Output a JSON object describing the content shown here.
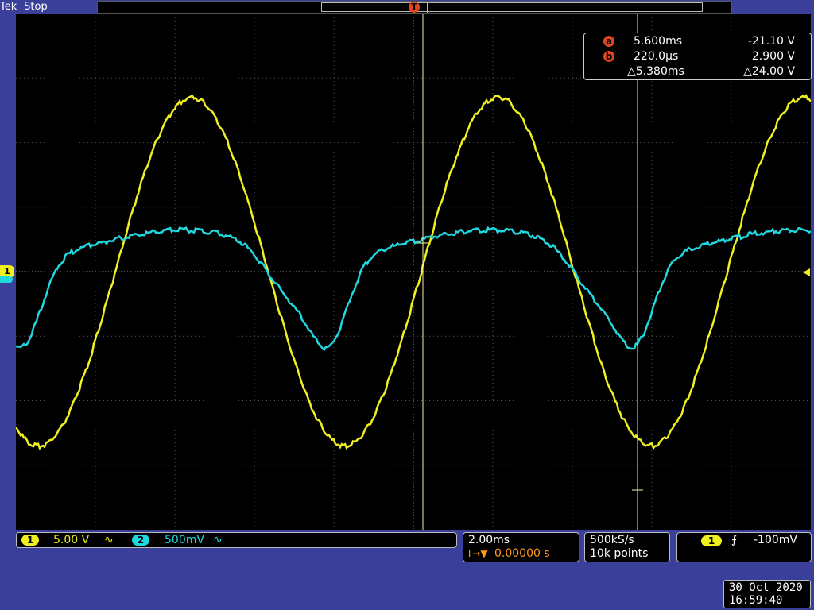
{
  "header": {
    "brand": "Tek",
    "state": "Stop"
  },
  "colors": {
    "ch1": "#f0f020",
    "ch2": "#20d8e0",
    "cursor": "#e2461e",
    "trigger": "#ff9a1a",
    "background": "#3a3f9a"
  },
  "markers": {
    "trigger_label": "T",
    "cursor_a": "a",
    "cursor_b": "b"
  },
  "cursors": {
    "a": {
      "label": "a",
      "time": "5.600ms",
      "voltage": "-21.10 V"
    },
    "b": {
      "label": "b",
      "time": "220.0µs",
      "voltage": "2.900 V"
    },
    "delta": {
      "time": "△5.380ms",
      "voltage": "△24.00 V"
    }
  },
  "channels": [
    {
      "id": "1",
      "scale": "5.00 V",
      "coupling": "∿"
    },
    {
      "id": "2",
      "scale": "500mV",
      "coupling": "∿"
    }
  ],
  "timebase": {
    "scale": "2.00ms",
    "position_icon": "T→▼",
    "position": "0.00000 s"
  },
  "acquisition": {
    "rate": "500kS/s",
    "points": "10k points"
  },
  "trigger": {
    "channel": "1",
    "slope": "⨍",
    "level": "-100mV"
  },
  "datetime": {
    "date": "30 Oct  2020",
    "time": "16:59:40"
  },
  "chart_data": {
    "type": "line",
    "series": [
      {
        "name": "1",
        "description": "sinusoid",
        "period_divisions": 3.85,
        "amplitude_divisions": 2.7
      },
      {
        "name": "2",
        "description": "distorted periodic",
        "period_divisions": 3.85
      }
    ]
  }
}
